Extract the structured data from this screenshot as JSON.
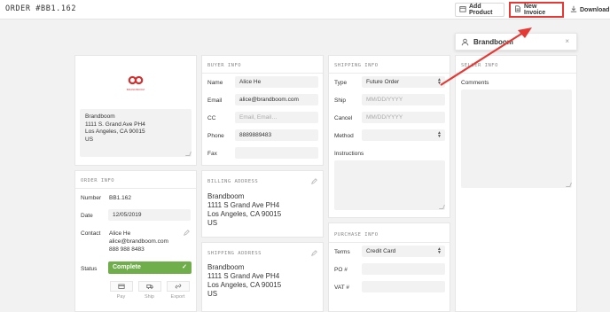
{
  "header": {
    "order_title": "ORDER #BB1.162",
    "add_product_label": "Add Product",
    "new_invoice_label": "New Invoice",
    "download_label": "Download"
  },
  "brand": {
    "logo_text": "BRANDBOOM",
    "address_lines": [
      "Brandboom",
      "1111 S. Grand Ave PH4",
      "Los Angeles, CA 90015",
      "US"
    ]
  },
  "order_info": {
    "title": "ORDER INFO",
    "number_label": "Number",
    "number_value": "BB1.162",
    "date_label": "Date",
    "date_value": "12/05/2019",
    "contact_label": "Contact",
    "contact_name": "Alice He",
    "contact_email": "alice@brandboom.com",
    "contact_phone": "888 988 8483",
    "status_label": "Status",
    "status_value": "Complete",
    "actions": [
      "Pay",
      "Ship",
      "Export"
    ]
  },
  "buyer_info": {
    "title": "BUYER INFO",
    "name_label": "Name",
    "name_value": "Alice He",
    "email_label": "Email",
    "email_value": "alice@brandboom.com",
    "cc_label": "CC",
    "cc_placeholder": "Email, Email…",
    "phone_label": "Phone",
    "phone_value": "8889889483",
    "fax_label": "Fax",
    "fax_value": ""
  },
  "billing_address": {
    "title": "BILLING ADDRESS",
    "lines": [
      "Brandboom",
      "1111 S Grand Ave PH4",
      "Los Angeles, CA 90015",
      "US"
    ]
  },
  "shipping_address": {
    "title": "SHIPPING ADDRESS",
    "lines": [
      "Brandboom",
      "1111 S Grand Ave PH4",
      "Los Angeles, CA 90015",
      "US"
    ]
  },
  "shipping_info": {
    "title": "SHIPPING INFO",
    "type_label": "Type",
    "type_value": "Future Order",
    "ship_label": "Ship",
    "ship_placeholder": "MM/DD/YYYY",
    "cancel_label": "Cancel",
    "cancel_placeholder": "MM/DD/YYYY",
    "method_label": "Method",
    "method_value": "",
    "instructions_label": "Instructions"
  },
  "purchase_info": {
    "title": "PURCHASE INFO",
    "terms_label": "Terms",
    "terms_value": "Credit Card",
    "po_label": "PO #",
    "po_value": "",
    "vat_label": "VAT #",
    "vat_value": ""
  },
  "seller_info": {
    "brand_name": "Brandboom",
    "title": "SELLER INFO",
    "comments_label": "Comments"
  },
  "colors": {
    "accent_red": "#e53935",
    "status_green": "#6fae4a",
    "logo_red": "#d32f2f"
  }
}
